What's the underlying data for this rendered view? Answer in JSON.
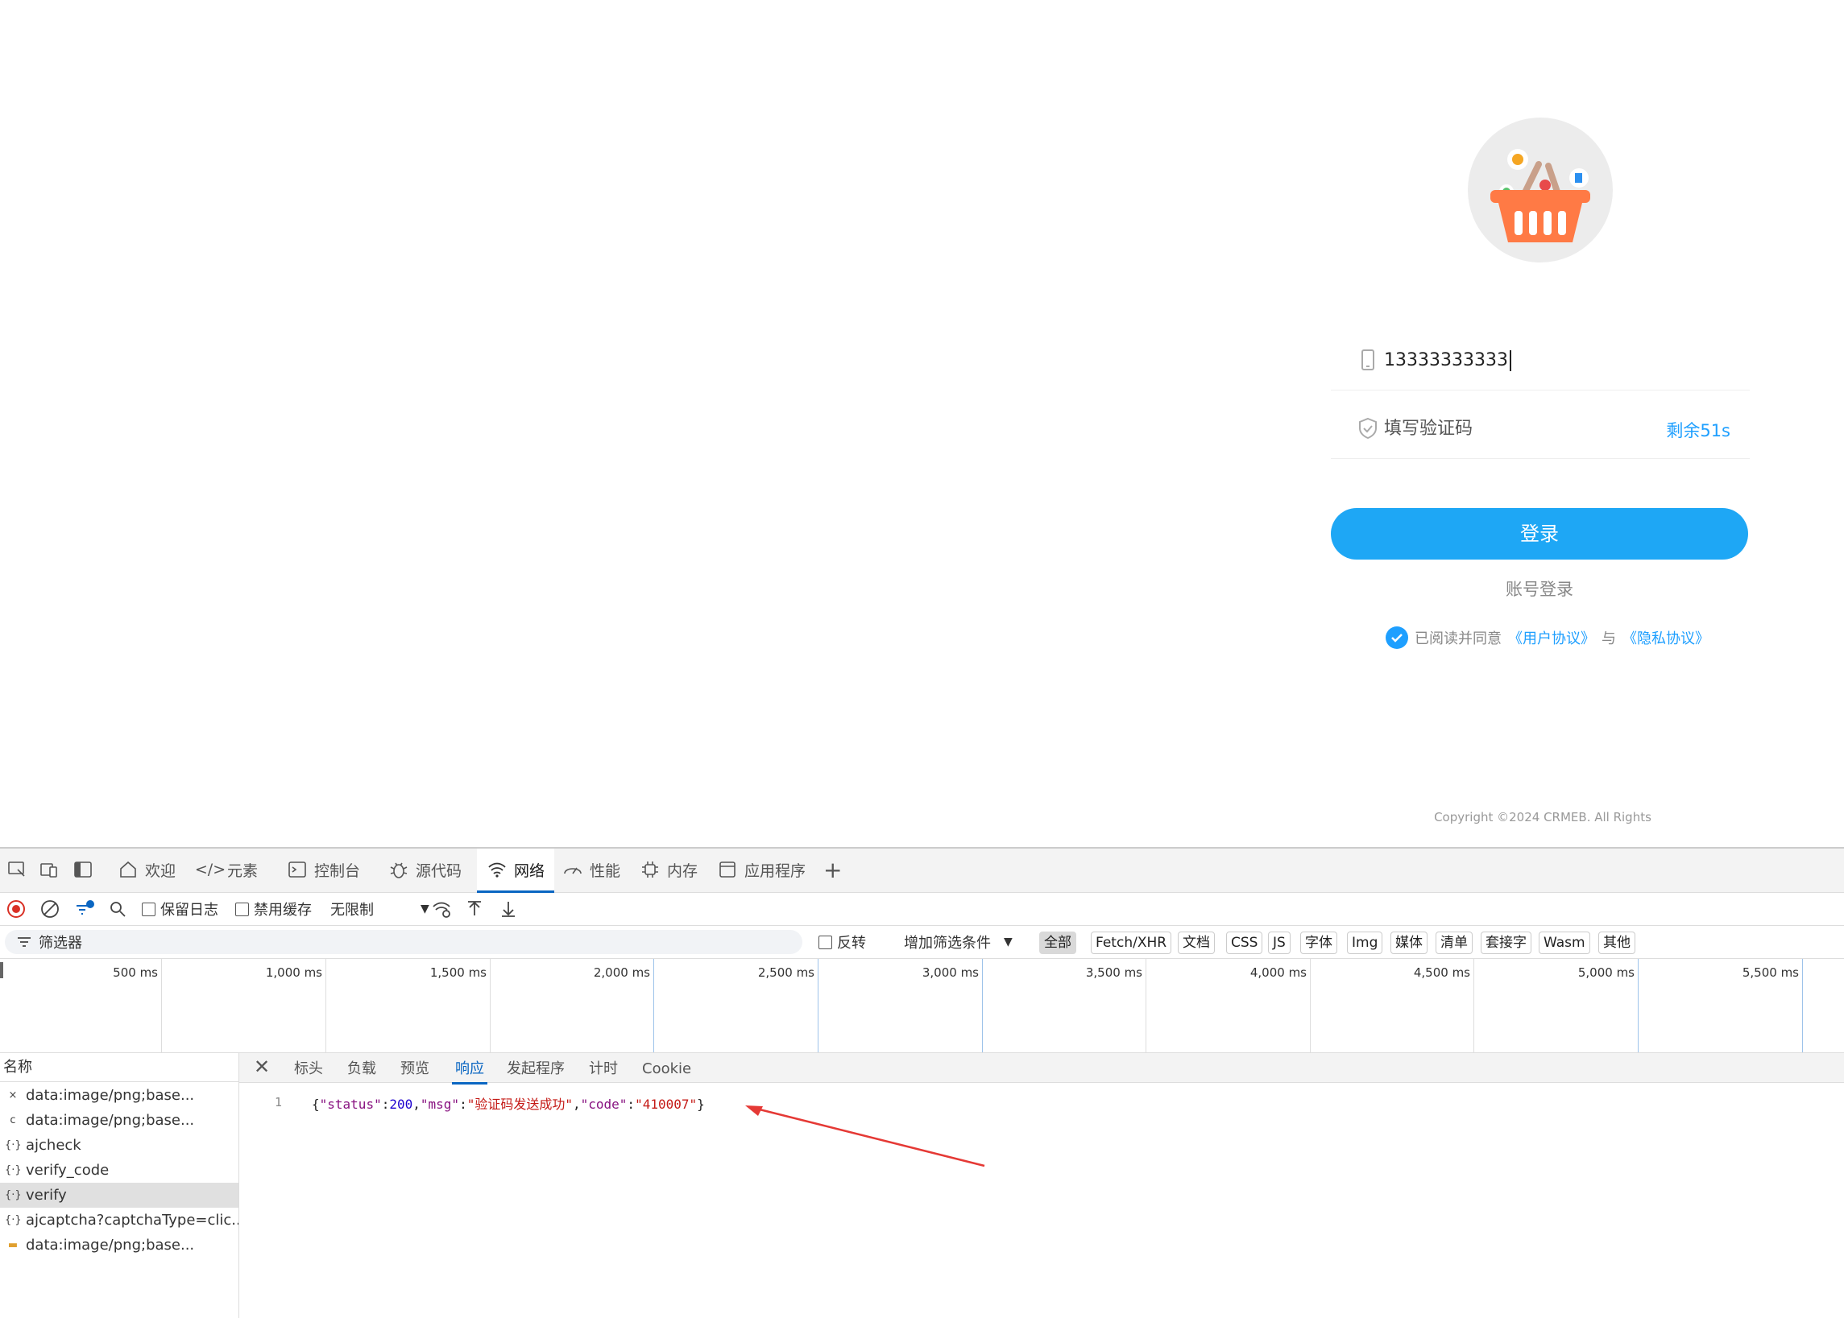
{
  "login": {
    "phone_value": "13333333333",
    "code_placeholder": "填写验证码",
    "countdown": "剩余51s",
    "login_button": "登录",
    "account_login": "账号登录",
    "agree_prefix": "已阅读并同意",
    "user_agreement": "《用户协议》",
    "agree_and": "与",
    "privacy_policy": "《隐私协议》",
    "copyright": "Copyright ©2024 CRMEB. All Rights"
  },
  "devtools": {
    "tabs": [
      "欢迎",
      "元素",
      "控制台",
      "源代码",
      "网络",
      "性能",
      "内存",
      "应用程序"
    ],
    "active_tab": "网络",
    "toolbar": {
      "preserve_log": "保留日志",
      "disable_cache": "禁用缓存",
      "throttling": "无限制"
    },
    "filter": {
      "placeholder": "筛选器",
      "invert": "反转",
      "more_filters": "增加筛选条件",
      "types": [
        "全部",
        "Fetch/XHR",
        "文档",
        "CSS",
        "JS",
        "字体",
        "Img",
        "媒体",
        "清单",
        "套接字",
        "Wasm",
        "其他"
      ],
      "active_type": "全部"
    },
    "timeline_ticks": [
      "500 ms",
      "1,000 ms",
      "1,500 ms",
      "2,000 ms",
      "2,500 ms",
      "3,000 ms",
      "3,500 ms",
      "4,000 ms",
      "4,500 ms",
      "5,000 ms",
      "5,500 ms"
    ],
    "name_header": "名称",
    "requests": [
      {
        "icon": "×",
        "name": "data:image/png;base..."
      },
      {
        "icon": "c",
        "name": "data:image/png;base..."
      },
      {
        "icon": "{·}",
        "name": "ajcheck"
      },
      {
        "icon": "{·}",
        "name": "verify_code"
      },
      {
        "icon": "{·}",
        "name": "verify",
        "selected": true
      },
      {
        "icon": "{·}",
        "name": "ajcaptcha?captchaType=clic..."
      },
      {
        "icon": "▬",
        "name": "data:image/png;base..."
      }
    ],
    "detail_tabs": [
      "标头",
      "负载",
      "预览",
      "响应",
      "发起程序",
      "计时",
      "Cookie"
    ],
    "active_detail_tab": "响应",
    "response": {
      "line_number": "1",
      "open": "{",
      "k1": "\"status\"",
      "v1": "200",
      "k2": "\"msg\"",
      "v2": "\"验证码发送成功\"",
      "k3": "\"code\"",
      "v3": "\"410007\"",
      "close": "}"
    }
  },
  "colors": {
    "accent": "#1e9fff",
    "button": "#1ea7f5",
    "basket": "#ff7a45",
    "arrow": "#e53935"
  }
}
